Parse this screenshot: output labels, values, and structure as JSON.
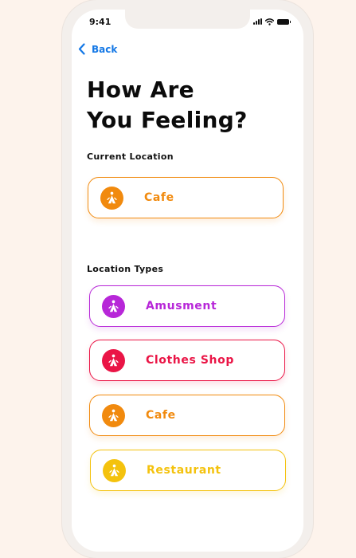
{
  "status_bar": {
    "time": "9:41"
  },
  "nav": {
    "back_label": "Back"
  },
  "header": {
    "title_line1": "How Are",
    "title_line2": "You Feeling?"
  },
  "current_location": {
    "label": "Current Location",
    "item": {
      "label": "Cafe",
      "color": "#f18a0e",
      "icon": "person-walking-icon"
    }
  },
  "location_types": {
    "label": "Location Types",
    "items": [
      {
        "label": "Amusment",
        "color": "#b727d8",
        "icon": "person-walking-icon"
      },
      {
        "label": "Clothes Shop",
        "color": "#ea1546",
        "icon": "person-walking-icon"
      },
      {
        "label": "Cafe",
        "color": "#f18a0e",
        "icon": "person-walking-icon"
      },
      {
        "label": "Restaurant",
        "color": "#f4c20d",
        "icon": "person-walking-icon"
      }
    ]
  }
}
